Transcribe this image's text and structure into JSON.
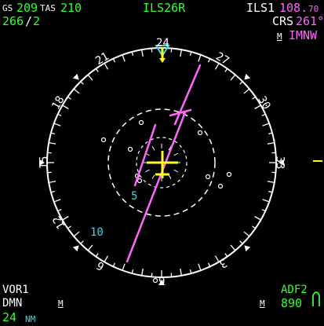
{
  "top_left": {
    "gs_label": "GS",
    "gs_value": "209",
    "tas_label": "TAS",
    "tas_value": "210",
    "wind_dir": "266",
    "wind_sep": "/",
    "wind_speed": "2"
  },
  "top_center": {
    "approach": "ILS26R"
  },
  "top_right": {
    "nav_source": "ILS1",
    "frequency_main": "108.",
    "frequency_dec": "70",
    "crs_label": "CRS",
    "crs_value": "261°",
    "m_label": "M",
    "ident": "IMNW"
  },
  "compass": {
    "heading_labels": [
      "24",
      "27",
      "30",
      "33",
      "3",
      "6",
      "9",
      "12",
      "15",
      "18",
      "21"
    ],
    "range_labels": [
      "5",
      "10"
    ]
  },
  "bottom_left": {
    "vor_label": "VOR1",
    "vor_ident": "DMN",
    "m_label": "M",
    "distance": "24",
    "distance_unit": "NM"
  },
  "bottom_right": {
    "m_label": "M",
    "adf_label": "ADF2",
    "adf_value": "890"
  },
  "colors": {
    "white": "#ffffff",
    "green": "#33ff33",
    "magenta": "#ff66ff",
    "cyan": "#33ddee",
    "yellow": "#ffff22",
    "background": "#000000"
  },
  "icons": [
    "aircraft-symbol-icon",
    "heading-bug-icon",
    "adf-needle-icon"
  ]
}
